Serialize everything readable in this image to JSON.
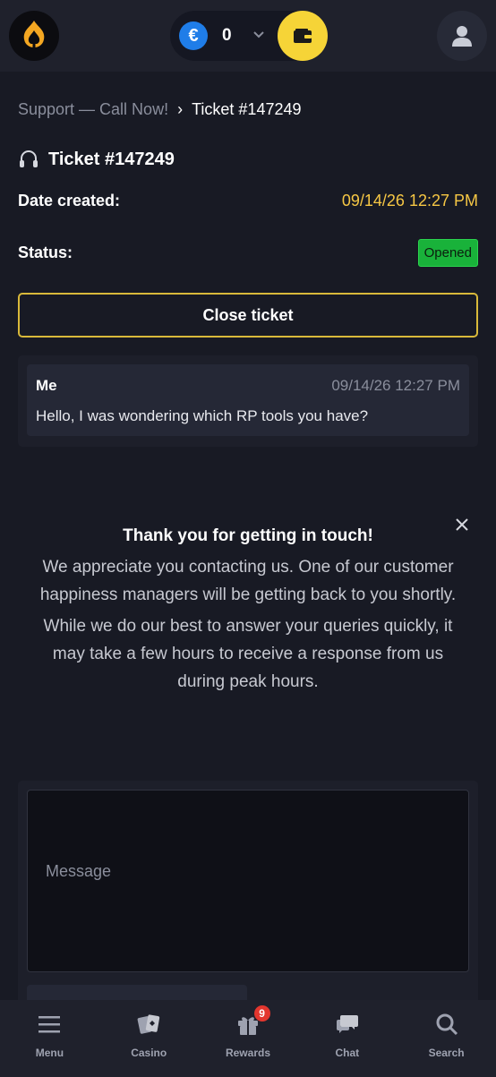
{
  "header": {
    "currency_symbol": "€",
    "balance": "0"
  },
  "breadcrumb": {
    "parent": "Support — Call Now!",
    "separator": "›",
    "current": "Ticket #147249"
  },
  "ticket": {
    "title": "Ticket #147249",
    "date_label": "Date created:",
    "date_value": "09/14/26 12:27 PM",
    "status_label": "Status:",
    "status_value": "Opened",
    "close_label": "Close ticket"
  },
  "message": {
    "author": "Me",
    "time": "09/14/26 12:27 PM",
    "text": "Hello, I was wondering which RP tools you have?"
  },
  "notice": {
    "close_symbol": "×",
    "title": "Thank you for getting in touch!",
    "p1": "We appreciate you contacting us. One of our customer happiness managers will be getting back to you shortly.",
    "p2": "While we do our best to answer your queries quickly, it may take a few hours to receive a response from us during peak hours."
  },
  "composer": {
    "placeholder": "Message"
  },
  "nav": {
    "items": [
      {
        "label": "Menu",
        "icon": "menu-icon"
      },
      {
        "label": "Casino",
        "icon": "cards-icon"
      },
      {
        "label": "Rewards",
        "icon": "gift-icon",
        "badge": "9"
      },
      {
        "label": "Chat",
        "icon": "chat-icon"
      },
      {
        "label": "Search",
        "icon": "search-icon"
      }
    ]
  },
  "colors": {
    "accent_yellow": "#f6d437",
    "status_green": "#19b23a",
    "date_orange": "#f6c744",
    "badge_red": "#e3362e"
  }
}
